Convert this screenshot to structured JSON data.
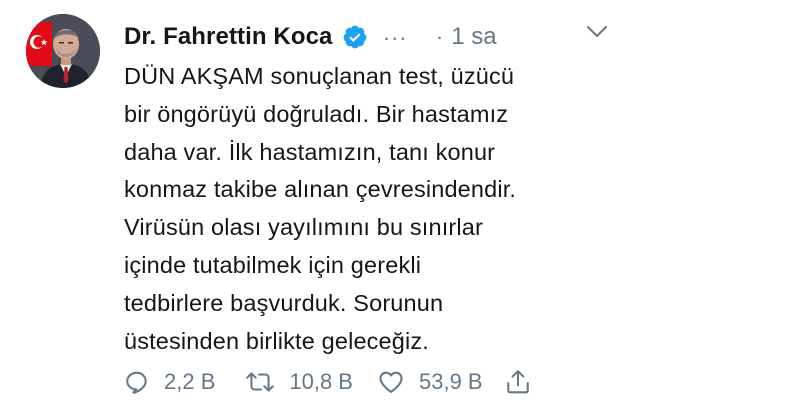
{
  "tweet": {
    "author_name": "Dr. Fahrettin Koca",
    "more_glyph": "...",
    "separator": "·",
    "time": "1 sa",
    "text": "DÜN AKŞAM sonuçlanan test, üzücü\nbir öngörüyü doğruladı. Bir hastamız\ndaha var. İlk hastamızın, tanı konur\nkonmaz takibe alınan çevresindendir.\nVirüsün olası yayılımını bu sınırlar\niçinde tutabilmek için gerekli\ntedbirlere başvurduk. Sorunun\nüstesinden birlikte geleceğiz.",
    "replies": "2,2 B",
    "retweets": "10,8 B",
    "likes": "53,9 B"
  },
  "icons": {
    "verified": "verified-badge-icon",
    "menu": "chevron-down-icon",
    "reply": "reply-icon",
    "retweet": "retweet-icon",
    "like": "heart-icon",
    "share": "share-icon"
  },
  "colors": {
    "text": "#14171a",
    "muted": "#657786",
    "verified": "#1da1f2",
    "flag_red": "#e30a17"
  }
}
